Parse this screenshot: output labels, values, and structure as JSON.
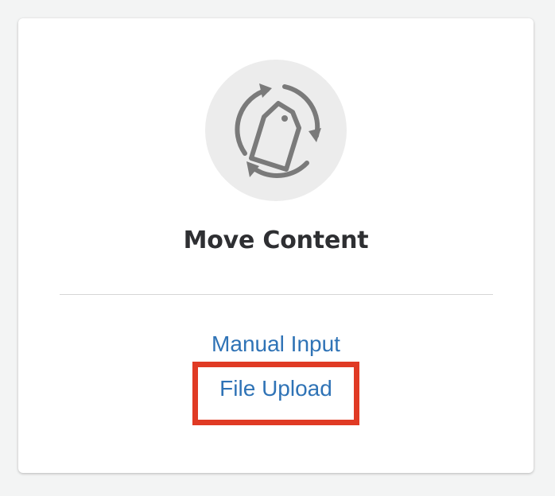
{
  "card": {
    "icon": "tag-sync-icon",
    "title": "Move Content"
  },
  "links": {
    "manual_input": "Manual Input",
    "file_upload": "File Upload"
  },
  "colors": {
    "link": "#2f73b6",
    "highlight": "#e03a24",
    "title": "#2e2f32",
    "icon_bg": "#ececec",
    "icon_stroke": "#7a7a7a"
  }
}
